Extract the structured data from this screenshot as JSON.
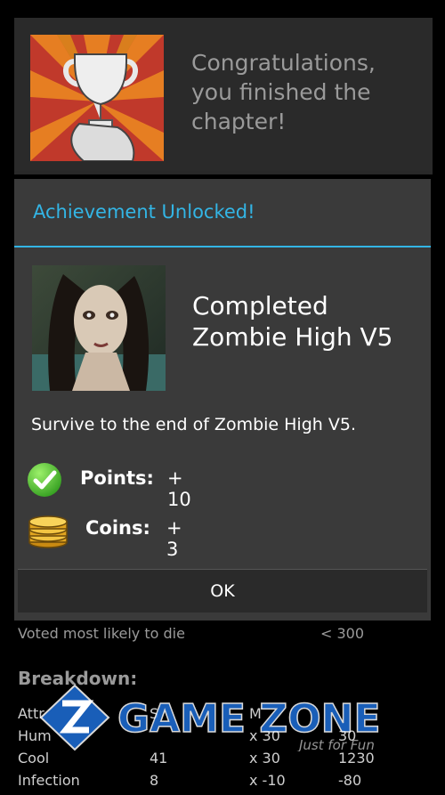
{
  "congrats": {
    "message": "Congratulations, you finished the chapter!",
    "icon": "trophy-icon"
  },
  "dialog": {
    "title": "Achievement Unlocked!",
    "achievement_name": "Completed Zombie High V5",
    "description": "Survive to the end of Zombie High V5.",
    "points_label": "Points:",
    "points_value": "+ 10",
    "coins_label": "Coins:",
    "coins_value": "+ 3",
    "ok_label": "OK",
    "accent_color": "#33b5e5"
  },
  "background": {
    "voted_label": "Voted most likely to die",
    "voted_value": "< 300",
    "breakdown_title": "Breakdown:",
    "rows": [
      [
        "Attr",
        "S",
        "M",
        ""
      ],
      [
        "Hum",
        "",
        "x 30",
        "30"
      ],
      [
        "Cool",
        "41",
        "x 30",
        "1230"
      ],
      [
        "Infection",
        "8",
        "x -10",
        "-80"
      ]
    ]
  },
  "watermark": {
    "brand": "GAME ZONE",
    "tagline": "Just for Fun"
  }
}
